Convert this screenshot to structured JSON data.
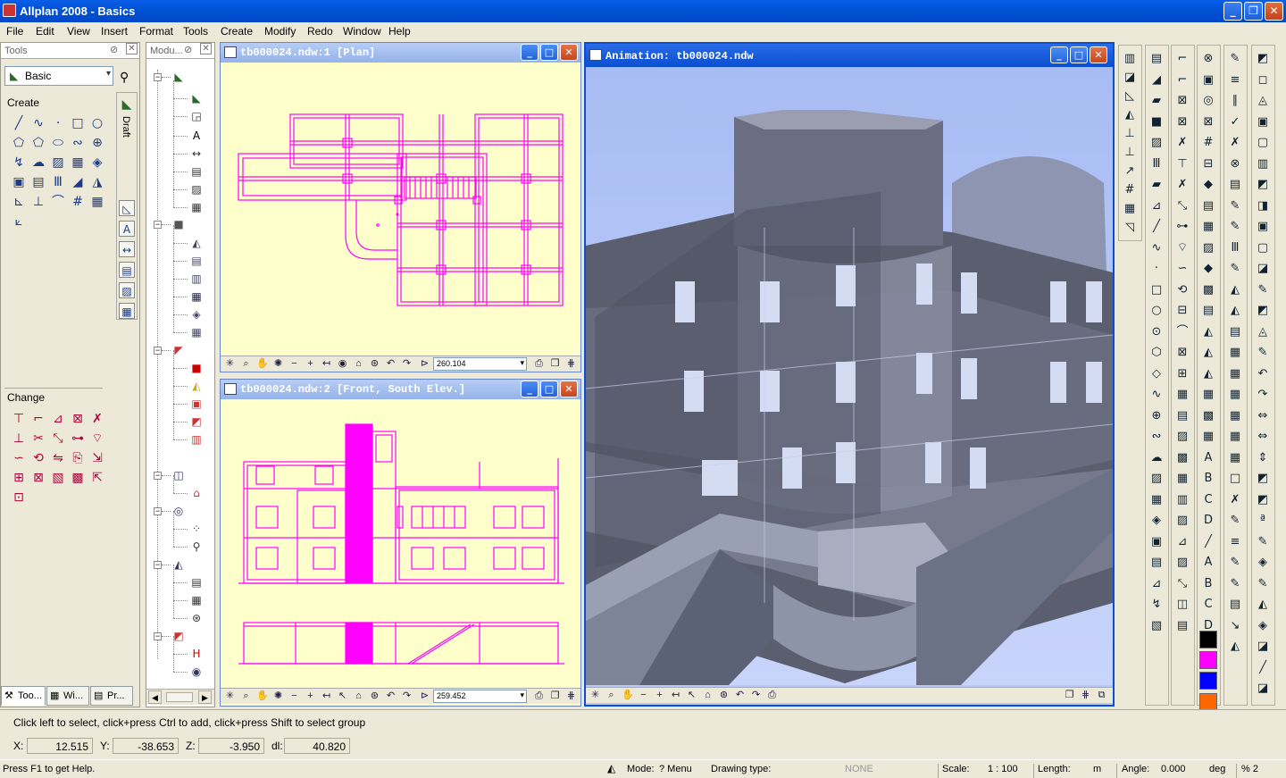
{
  "app": {
    "title": "Allplan 2008 - Basics"
  },
  "menu": [
    "File",
    "Edit",
    "View",
    "Insert",
    "Format",
    "Tools",
    "Create",
    "Modify",
    "Redo",
    "Window",
    "Help"
  ],
  "tools_panel": {
    "title": "Tools",
    "module_select": "Basic",
    "create_label": "Create",
    "change_label": "Change",
    "draft_label": "Draft",
    "tabs": [
      "Too...",
      "Wi...",
      "Pr..."
    ]
  },
  "module_panel": {
    "title": "Modu..."
  },
  "window_plan": {
    "title": "tb000024.ndw:1 [Plan]",
    "scale": "260.104"
  },
  "window_front": {
    "title": "tb000024.ndw:2 [Front, South Elev.]",
    "scale": "259.452"
  },
  "window_anim": {
    "title": "Animation: tb000024.ndw"
  },
  "status": {
    "prompt": "Click left to select, click+press Ctrl to add, click+press Shift to select group",
    "x_label": "X:",
    "x_value": "12.515",
    "y_label": "Y:",
    "y_value": "-38.653",
    "z_label": "Z:",
    "z_value": "-3.950",
    "dl_label": "dl:",
    "dl_value": "40.820",
    "help": "Press F1 to get Help.",
    "mode_label": "Mode:",
    "mode_value": "? Menu",
    "drawing_type_label": "Drawing type:",
    "drawing_type_value": "NONE",
    "scale_label": "Scale:",
    "scale_value": "1 : 100",
    "length_label": "Length:",
    "length_value": "m",
    "angle_label": "Angle:",
    "angle_value": "0.000",
    "angle_unit": "deg",
    "percent": "% 2"
  },
  "colors": {
    "magenta": "#ff00ff",
    "plan_bg": "#ffffcc",
    "sky": "#b8c8f8",
    "accent": "#0a5ee8"
  }
}
